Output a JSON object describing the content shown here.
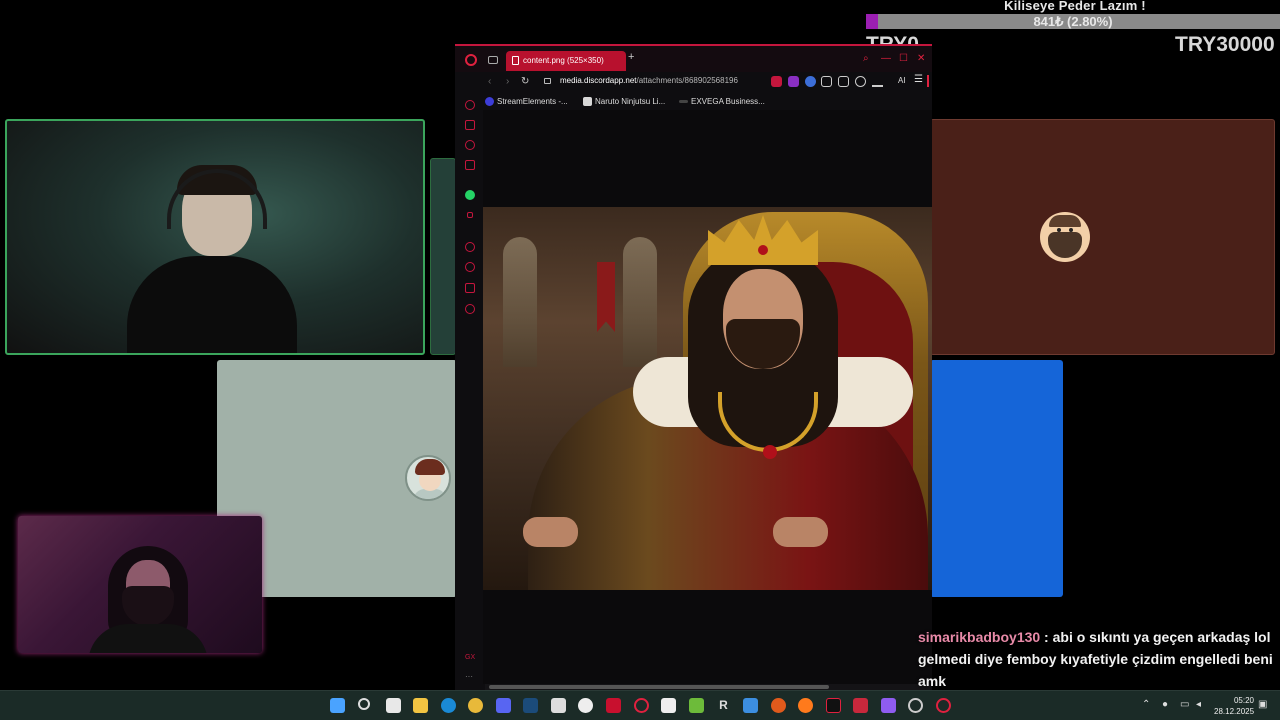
{
  "goal": {
    "title": "Kiliseye Peder Lazım !",
    "amount": "841₺ (2.80%)",
    "progress_fraction": 0.028,
    "min_label": "TRY0",
    "max_label": "TRY30000"
  },
  "browser": {
    "tab_title": "content.png (525×350)",
    "new_tab": "+",
    "url_host": "media.discordapp.net",
    "url_path": "/attachments/868902568196",
    "ai_label": "AI",
    "bookmarks": [
      {
        "label": "StreamElements -..."
      },
      {
        "label": "Naruto Ninjutsu Li..."
      },
      {
        "label": "EXVEGA Business..."
      }
    ],
    "sidebar_bottom_label": "GX",
    "accent_color": "#c4163d"
  },
  "chat": {
    "username": "simarikbadboy130",
    "separator": " : ",
    "message": "abi o sıkıntı ya geçen arkadaş lol gelmedi diye femboy kıyafetiyle çizdim engelledi beni amk"
  },
  "taskbar": {
    "clock_time": "05:20",
    "clock_date": "28.12.2025"
  },
  "colors": {
    "speaking_border": "#3ba55c",
    "goal_fill": "#9b1fb2",
    "tile_red": "#4a2018",
    "tile_blue": "#1565d8",
    "tile_grey": "#a1b1a8"
  }
}
